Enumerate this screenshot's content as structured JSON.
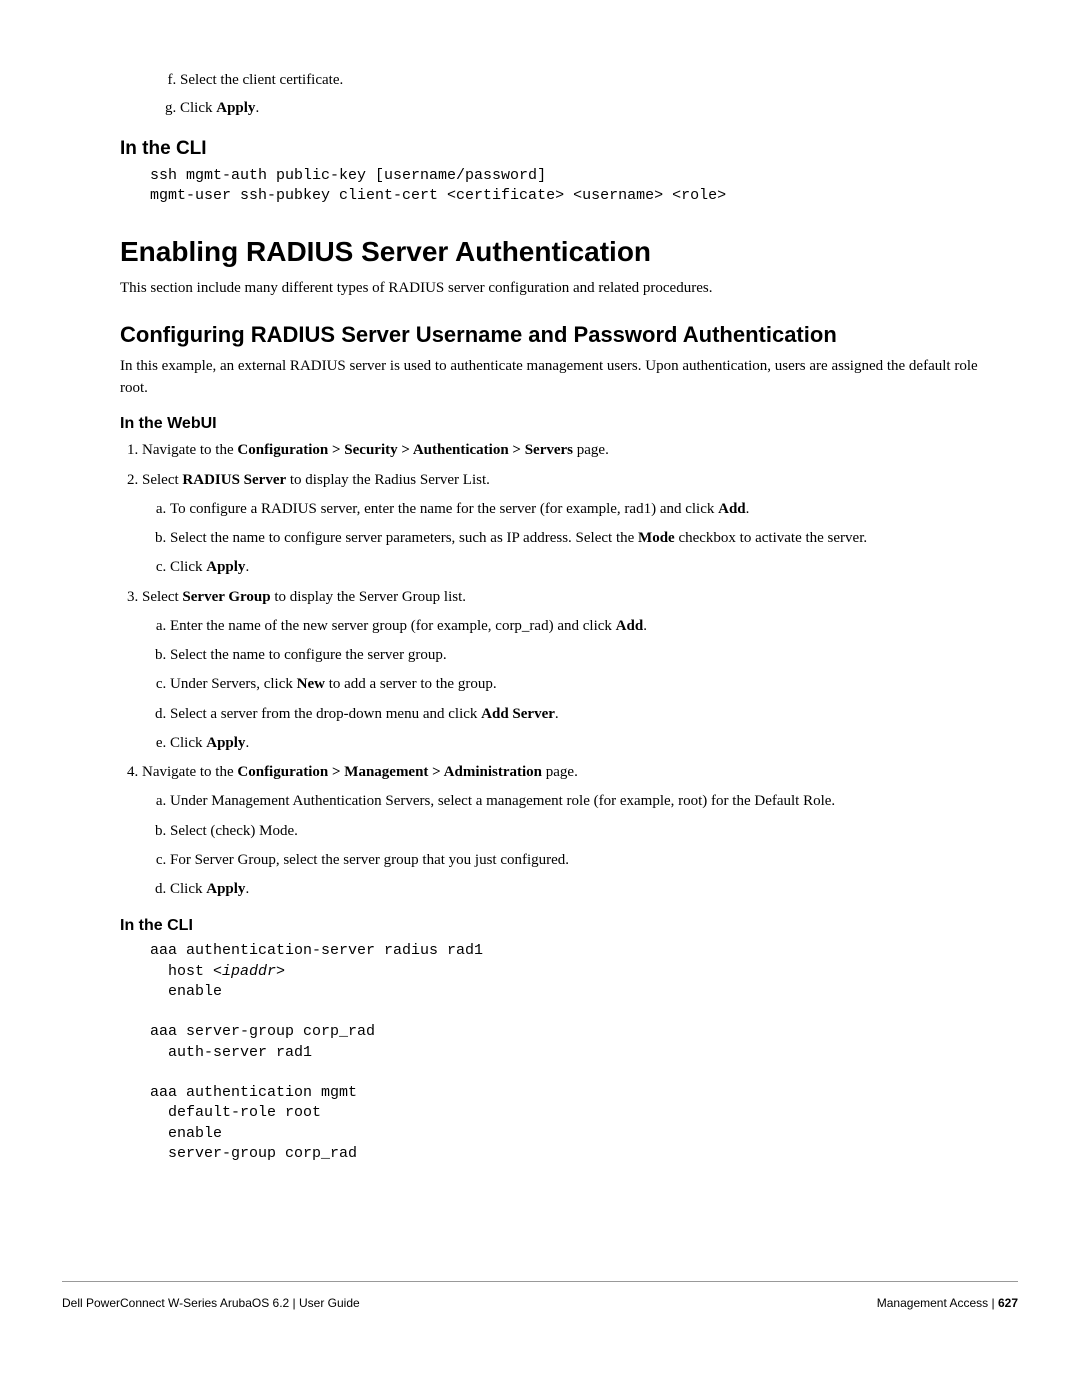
{
  "toplist": {
    "f": "Select the client certificate.",
    "g_pre": "Click ",
    "g_bold": "Apply",
    "g_post": "."
  },
  "cli1": {
    "heading": "In the CLI",
    "code": "ssh mgmt-auth public-key [username/password]\nmgmt-user ssh-pubkey client-cert <certificate> <username> <role>"
  },
  "main_heading": "Enabling RADIUS Server Authentication",
  "main_para": "This section include many different types of RADIUS server configuration and related procedures.",
  "sub_heading": "Configuring RADIUS Server Username and Password Authentication",
  "sub_para": "In this example, an external RADIUS server is used to authenticate management users. Upon authentication, users are assigned the default role root.",
  "webui": {
    "heading": "In the WebUI",
    "s1_pre": "Navigate to the ",
    "s1_bold": "Configuration > Security > Authentication > Servers",
    "s1_post": " page.",
    "s2_pre": "Select ",
    "s2_bold": "RADIUS Server",
    "s2_post": " to display the Radius Server List.",
    "s2a_pre": "To configure a RADIUS server, enter the name for the server (for example, rad1) and click ",
    "s2a_bold": "Add",
    "s2a_post": ".",
    "s2b_pre": "Select the name to configure server parameters, such as IP address. Select the ",
    "s2b_bold": "Mode",
    "s2b_post": " checkbox to activate the server.",
    "s2c_pre": "Click ",
    "s2c_bold": "Apply",
    "s2c_post": ".",
    "s3_pre": "Select ",
    "s3_bold": "Server Group",
    "s3_post": " to display the Server Group list.",
    "s3a_pre": "Enter the name of the new server group (for example, corp_rad) and click ",
    "s3a_bold": "Add",
    "s3a_post": ".",
    "s3b": "Select the name to configure the server group.",
    "s3c_pre": "Under Servers, click ",
    "s3c_bold": "New",
    "s3c_post": " to add a server to the group.",
    "s3d_pre": "Select a server from the drop-down menu and click ",
    "s3d_bold": "Add Server",
    "s3d_post": ".",
    "s3e_pre": "Click ",
    "s3e_bold": "Apply",
    "s3e_post": ".",
    "s4_pre": "Navigate to the ",
    "s4_bold": "Configuration > Management > Administration",
    "s4_post": " page.",
    "s4a": "Under Management Authentication Servers, select a management role (for example, root) for the Default Role.",
    "s4b": "Select (check) Mode.",
    "s4c": "For Server Group, select the server group that you just configured.",
    "s4d_pre": "Click ",
    "s4d_bold": "Apply",
    "s4d_post": "."
  },
  "cli2": {
    "heading": "In the CLI",
    "l1": "aaa authentication-server radius rad1",
    "l2a": "  host <",
    "l2b": "ipaddr",
    "l2c": ">",
    "l3": "  enable",
    "l4": "",
    "l5": "aaa server-group corp_rad",
    "l6": "  auth-server rad1",
    "l7": "",
    "l8": "aaa authentication mgmt",
    "l9": "  default-role root",
    "l10": "  enable",
    "l11": "  server-group corp_rad"
  },
  "footer": {
    "left": "Dell PowerConnect W-Series ArubaOS 6.2  |  User Guide",
    "right_label": "Management Access",
    "right_sep": " | ",
    "right_page": "627"
  }
}
